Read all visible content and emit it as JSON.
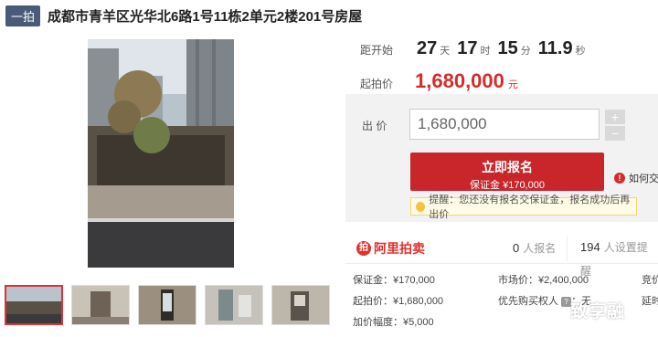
{
  "header": {
    "tag": "一拍",
    "title": "成都市青羊区光华北6路1号11栋2单元2楼201号房屋"
  },
  "countdown": {
    "label": "距开始",
    "days": "27",
    "days_unit": "天",
    "hours": "17",
    "hours_unit": "时",
    "minutes": "15",
    "minutes_unit": "分",
    "seconds": "11.9",
    "seconds_unit": "秒"
  },
  "start_price": {
    "label": "起拍价",
    "value": "1,680,000",
    "unit": "元"
  },
  "bid": {
    "label": "出 价",
    "value": "1,680,000",
    "plus": "+",
    "minus": "−",
    "signup_label": "立即报名",
    "deposit_label": "保证金 ¥170,000",
    "help_label": "如何交"
  },
  "tip": {
    "text": "提醒：您还没有报名交保证金，报名成功后再出价"
  },
  "stats": {
    "logo": "阿里拍卖",
    "signups_count": "0",
    "signups_label": "人报名",
    "reminders_count": "194",
    "reminders_label": "人设置提醒"
  },
  "info": {
    "deposit": "保证金：¥170,000",
    "market_price": "市场价：¥2,400,000",
    "bid_col": "竞价",
    "start_price": "起拍价：¥1,680,000",
    "priority": "优先购买权人",
    "priority_value": "：无",
    "delay_col": "延时",
    "increment": "加价幅度：¥5,000"
  },
  "watermark": "致享融",
  "colors": {
    "accent": "#c8262b",
    "price": "#d62b2b",
    "tag_bg": "#4a5a78",
    "panel_bg": "#f2f2f2"
  }
}
